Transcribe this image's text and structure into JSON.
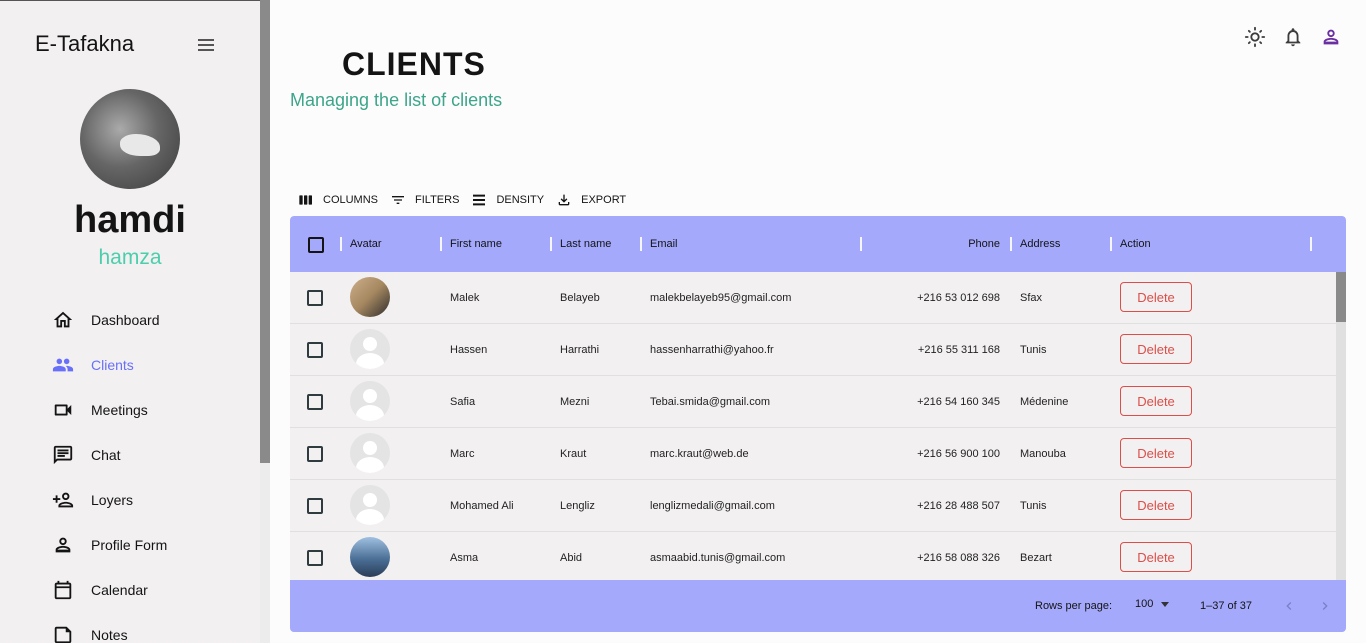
{
  "sidebar": {
    "brand": "E-Tafakna",
    "user_name": "hamdi",
    "user_role": "hamza",
    "items": [
      {
        "label": "Dashboard",
        "icon": "home-icon",
        "active": false
      },
      {
        "label": "Clients",
        "icon": "people-icon",
        "active": true
      },
      {
        "label": "Meetings",
        "icon": "video-icon",
        "active": false
      },
      {
        "label": "Chat",
        "icon": "chat-icon",
        "active": false
      },
      {
        "label": "Loyers",
        "icon": "person-add-icon",
        "active": false
      },
      {
        "label": "Profile Form",
        "icon": "person-icon",
        "active": false
      },
      {
        "label": "Calendar",
        "icon": "calendar-icon",
        "active": false
      },
      {
        "label": "Notes",
        "icon": "note-icon",
        "active": false
      }
    ]
  },
  "header": {
    "title": "CLIENTS",
    "subtitle": "Managing the list of clients"
  },
  "toolbar": {
    "columns": "COLUMNS",
    "filters": "FILTERS",
    "density": "DENSITY",
    "export": "EXPORT"
  },
  "grid": {
    "headers": {
      "avatar": "Avatar",
      "first_name": "First name",
      "last_name": "Last name",
      "email": "Email",
      "phone": "Phone",
      "address": "Address",
      "action": "Action"
    },
    "delete_label": "Delete",
    "rows": [
      {
        "avatar": "photo1",
        "first": "Malek",
        "last": "Belayeb",
        "email": "malekbelayeb95@gmail.com",
        "phone": "+216 53 012 698",
        "address": "Sfax"
      },
      {
        "avatar": "default",
        "first": "Hassen",
        "last": "Harrathi",
        "email": "hassenharrathi@yahoo.fr",
        "phone": "+216 55 311 168",
        "address": "Tunis"
      },
      {
        "avatar": "default",
        "first": "Safia",
        "last": "Mezni",
        "email": "Tebai.smida@gmail.com",
        "phone": "+216 54 160 345",
        "address": "Médenine"
      },
      {
        "avatar": "default",
        "first": "Marc",
        "last": "Kraut",
        "email": "marc.kraut@web.de",
        "phone": "+216 56 900 100",
        "address": "Manouba"
      },
      {
        "avatar": "default",
        "first": "Mohamed Ali",
        "last": "Lengliz",
        "email": "lenglizmedali@gmail.com",
        "phone": "+216 28 488 507",
        "address": "Tunis"
      },
      {
        "avatar": "photo2",
        "first": "Asma",
        "last": "Abid",
        "email": "asmaabid.tunis@gmail.com",
        "phone": "+216 58 088 326",
        "address": "Bezart"
      }
    ],
    "footer": {
      "rows_per_page_label": "Rows per page:",
      "rows_per_page_value": "100",
      "range": "1–37 of 37"
    }
  },
  "colors": {
    "accent": "#6870fa",
    "header_bg": "#a4a9fc",
    "green": "#4cceac",
    "subtitle": "#3da58a",
    "danger": "#db4f4a"
  }
}
